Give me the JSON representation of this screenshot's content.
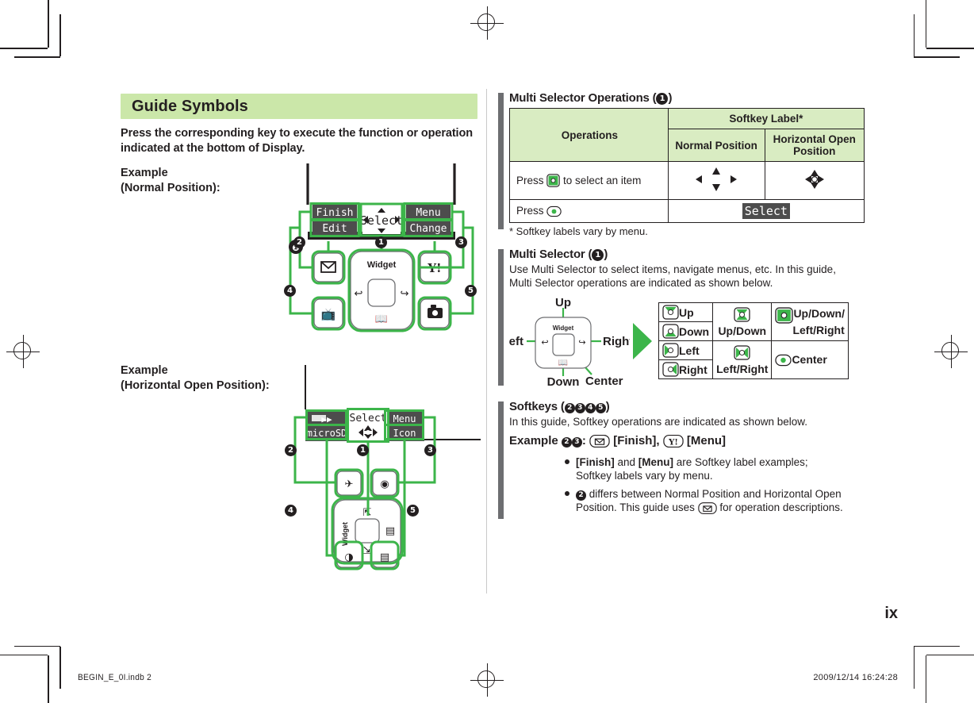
{
  "page": {
    "number": "ix",
    "footer_left": "BEGIN_E_0I.indb   2",
    "footer_right": "2009/12/14   16:24:28"
  },
  "left_column": {
    "banner_title": "Guide Symbols",
    "lead_text": "Press the corresponding key to execute the function or operation indicated at the bottom of Display.",
    "example_normal_line1": "Example",
    "example_normal_line2": "(Normal Position):",
    "example_horizontal_line1": "Example",
    "example_horizontal_line2": "(Horizontal Open Position):",
    "normal_position_diagram": {
      "softkeys": [
        {
          "top": "Finish",
          "bottom": "Edit"
        },
        {
          "top": "Select",
          "bottom": ""
        },
        {
          "top": "Menu",
          "bottom": "Change"
        }
      ],
      "callouts": [
        "1",
        "2",
        "3",
        "4",
        "5"
      ],
      "keys": [
        {
          "name": "mail-key",
          "glyph": "envelope"
        },
        {
          "name": "tv-key",
          "glyph": "tv"
        },
        {
          "name": "yahoo-key",
          "glyph": "Y!"
        },
        {
          "name": "camera-key",
          "glyph": "camera"
        }
      ],
      "multi_selector_label": "Widget"
    },
    "horizontal_position_diagram": {
      "softkeys": [
        {
          "top": "",
          "bottom": "microSD"
        },
        {
          "top": "Select",
          "bottom": ""
        },
        {
          "top": "Menu",
          "bottom": "Icon"
        }
      ],
      "callouts": [
        "1",
        "2",
        "3",
        "4",
        "5"
      ],
      "multi_selector_label": "Widget"
    }
  },
  "right_column": {
    "section_operations": {
      "heading": "Multi Selector Operations (",
      "heading_num": "1",
      "heading_close": ")",
      "table": {
        "col_operations": "Operations",
        "col_softkey_label": "Softkey Label*",
        "col_normal": "Normal Position",
        "col_horizontal": "Horizontal Open Position",
        "rows": [
          {
            "operation_pre": "Press",
            "operation_post": "to select an item",
            "icon": "multi-selector-all",
            "normal": "arrows-4way",
            "horizontal": "arrows-4way-solid"
          },
          {
            "operation_pre": "Press",
            "operation_post": "",
            "icon": "center-key",
            "merged_value": "Select"
          }
        ]
      },
      "footnote": "* Softkey labels vary by menu."
    },
    "section_multi_selector": {
      "heading": "Multi Selector (",
      "heading_num": "1",
      "heading_close": ")",
      "body": "Use Multi Selector to select items, navigate menus, etc. In this guide, Multi Selector operations are indicated as shown below.",
      "diagram_labels": {
        "up": "Up",
        "down": "Down",
        "left": "Left",
        "right": "Right",
        "center": "Center",
        "widget": "Widget"
      },
      "key_table": [
        [
          {
            "icon": "msel-up",
            "label": "Up"
          },
          {
            "icon": "msel-updown",
            "label": "Up/Down",
            "rowspan": 2,
            "stacked": true
          },
          {
            "icon": "msel-all",
            "label": "Up/Down/ Left/Right",
            "rowspan": 2,
            "lines": [
              "Up/Down/",
              "Left/Right"
            ]
          }
        ],
        [
          {
            "icon": "msel-down",
            "label": "Down"
          }
        ],
        [
          {
            "icon": "msel-left",
            "label": "Left"
          },
          {
            "icon": "msel-leftright",
            "label": "Left/Right",
            "rowspan": 2,
            "stacked": true
          },
          {
            "icon": "msel-center",
            "label": "Center",
            "rowspan": 2
          }
        ],
        [
          {
            "icon": "msel-right",
            "label": "Right"
          }
        ]
      ]
    },
    "section_softkeys": {
      "heading": "Softkeys (",
      "heading_nums": [
        "2",
        "3",
        "4",
        "5"
      ],
      "heading_close": ")",
      "body": "In this guide, Softkey operations are indicated as shown below.",
      "example_prefix": "Example",
      "example_nums": [
        "2",
        "3"
      ],
      "example_colon": ":",
      "example_label_1": "[Finish],",
      "example_label_2": "[Menu]",
      "bullets": [
        {
          "text_parts": [
            "[Finish]",
            " and ",
            "[Menu]",
            " are Softkey label examples;"
          ],
          "line2": "Softkey labels vary by menu."
        },
        {
          "num": "2",
          "text": " differs between Normal Position and Horizontal Open Position. This guide uses",
          "tail": "for operation descriptions."
        }
      ]
    }
  },
  "colors": {
    "banner_green": "#cbe7a9",
    "table_header_green": "#d9ecc2",
    "accent_green": "#3cb54a",
    "section_bar_gray": "#6d6e71",
    "ink": "#231f20"
  }
}
